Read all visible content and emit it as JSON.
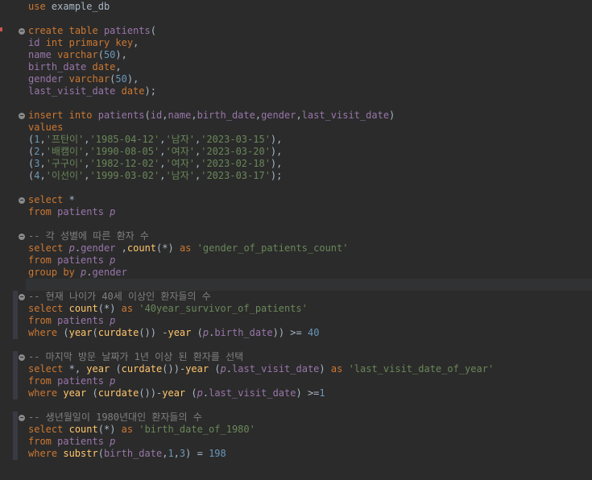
{
  "editor": {
    "lines": [
      "use example_db",
      "",
      "create table patients(",
      "id int primary key,",
      "name varchar(50),",
      "birth_date date,",
      "gender varchar(50),",
      "last_visit_date date);",
      "",
      "insert into patients(id,name,birth_date,gender,last_visit_date)",
      "values",
      "(1,'프탄이','1985-04-12','남자','2023-03-15'),",
      "(2,'배캠이','1990-08-05','여자','2023-03-20'),",
      "(3,'구구이','1982-12-02','여자','2023-02-18'),",
      "(4,'이선이','1999-03-02','남자','2023-03-17');",
      "",
      "select *",
      "from patients p",
      "",
      "-- 각 성별에 따른 환자 수",
      "select p.gender ,count(*) as 'gender_of_patients_count'",
      "from patients p",
      "group by p.gender",
      "",
      "-- 현재 나이가 40세 이상인 환자들의 수",
      "select count(*) as '40year_survivor_of_patients'",
      "from patients p",
      "where (year(curdate()) -year (p.birth_date)) >= 40",
      "",
      "-- 마지막 방문 날짜가 1년 이상 된 환자를 선택",
      "select *, year (curdate())-year (p.last_visit_date) as 'last_visit_date_of_year'",
      "from patients p",
      "where year (curdate())-year (p.last_visit_date) >=1",
      "",
      "-- 생년월일이 1980년대인 환자들의 수",
      "select count(*) as 'birth_date_of_1980'",
      "from patients p",
      "where substr(birth_date,1,3) = 198"
    ],
    "current_line": 23,
    "colors": {
      "background": "#2b2b2b",
      "keyword": "#cc7832",
      "identifier": "#9876aa",
      "function": "#ffc66d",
      "string": "#6a8759",
      "number": "#6897bb",
      "comment": "#808080",
      "plain": "#a9b7c6"
    }
  }
}
